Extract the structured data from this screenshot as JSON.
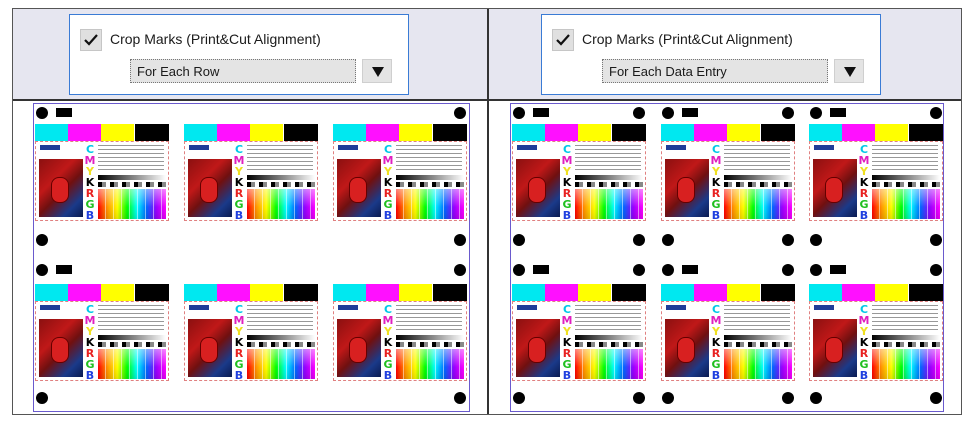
{
  "left": {
    "checkbox_label": "Crop Marks (Print&Cut Alignment)",
    "checked": true,
    "dropdown_value": "For Each Row"
  },
  "right": {
    "checkbox_label": "Crop Marks (Print&Cut Alignment)",
    "checked": true,
    "dropdown_value": "For Each Data Entry"
  },
  "card": {
    "letters": [
      "C",
      "M",
      "Y",
      "K",
      "R",
      "G",
      "B"
    ],
    "letter_colors": [
      "#00c8e8",
      "#e020c0",
      "#f0e020",
      "#000000",
      "#e82020",
      "#20c020",
      "#2040e0"
    ],
    "swatch_colors": [
      "#00e8f0",
      "#ff10ff",
      "#ffff00",
      "#000000"
    ]
  },
  "icons": {
    "checkbox": "checkmark-icon",
    "dropdown": "dropdown-arrow-icon",
    "crop_mark_dot": "registration-dot",
    "crop_mark_bar": "registration-bar"
  }
}
